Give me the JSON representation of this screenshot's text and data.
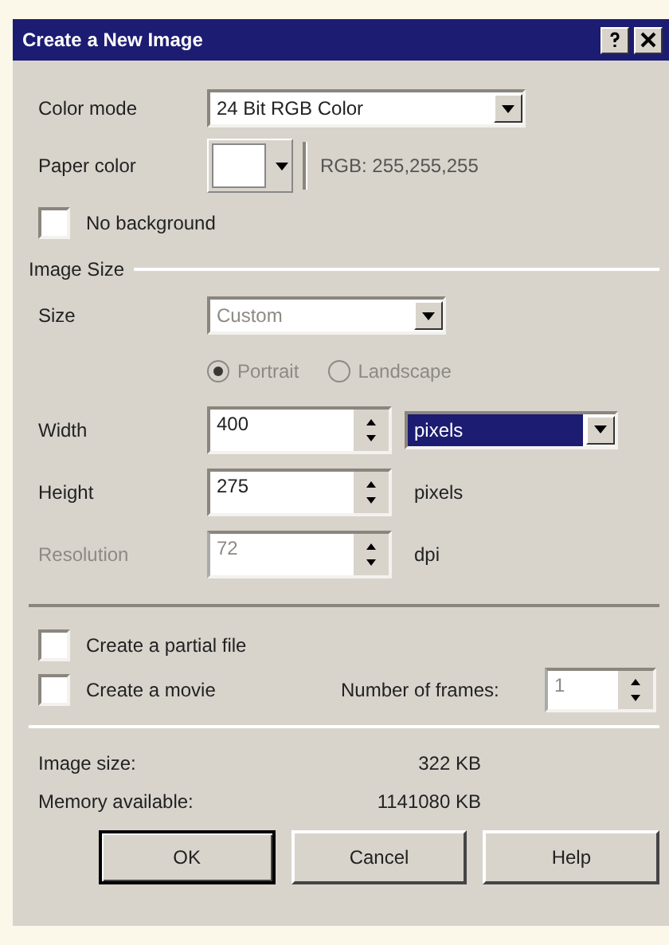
{
  "window": {
    "title": "Create a New Image"
  },
  "color_mode": {
    "label": "Color mode",
    "value": "24 Bit RGB Color"
  },
  "paper_color": {
    "label": "Paper color",
    "color": "#ffffff",
    "reading": "RGB: 255,255,255"
  },
  "no_background": {
    "label": "No background",
    "checked": false
  },
  "image_size": {
    "heading": "Image Size",
    "size": {
      "label": "Size",
      "value": "Custom"
    },
    "orientation": [
      {
        "label": "Portrait",
        "selected": true,
        "disabled": true
      },
      {
        "label": "Landscape",
        "selected": false,
        "disabled": true
      }
    ],
    "fields": [
      {
        "label": "Width",
        "value": "400",
        "disabled": false,
        "kind": "dropdown",
        "unit": "pixels",
        "focused": true
      },
      {
        "label": "Height",
        "value": "275",
        "disabled": false,
        "kind": "text",
        "unit": "pixels"
      },
      {
        "label": "Resolution",
        "value": "72",
        "disabled": true,
        "kind": "text",
        "unit": "dpi"
      }
    ]
  },
  "options": [
    {
      "label": "Create a partial file",
      "checked": false
    },
    {
      "label": "Create a movie",
      "checked": false
    }
  ],
  "frames": {
    "label": "Number of frames:",
    "value": "1",
    "disabled": true
  },
  "info": [
    {
      "label": "Image size:",
      "value": "322 KB"
    },
    {
      "label": "Memory available:",
      "value": "1141080 KB"
    }
  ],
  "buttons": [
    {
      "label": "OK",
      "default": true
    },
    {
      "label": "Cancel",
      "default": false
    },
    {
      "label": "Help",
      "default": false
    }
  ]
}
